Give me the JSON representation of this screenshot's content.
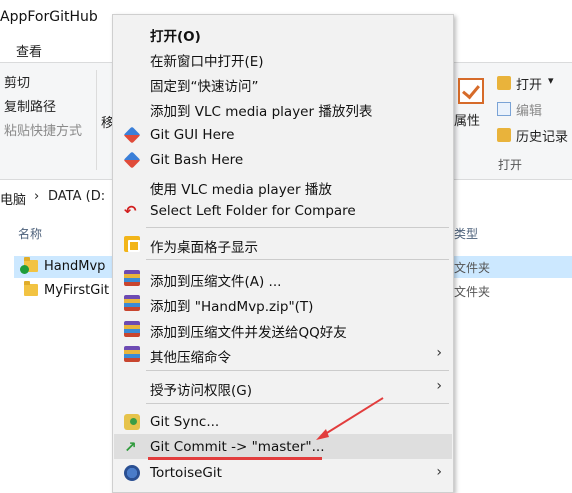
{
  "window": {
    "title": "AppForGitHub"
  },
  "ribbon": {
    "tab_label": "查看",
    "cut": "剪切",
    "copy_path": "复制路径",
    "paste_shortcut": "粘贴快捷方式",
    "move_partial": "移",
    "properties": "属性",
    "open": "打开",
    "open_arrow": "▾",
    "edit": "编辑",
    "history": "历史记录",
    "open_group": "打开"
  },
  "address": {
    "pc": "电脑",
    "sep": "›",
    "drive": "DATA (D:"
  },
  "columns": {
    "name": "名称",
    "type": "类型"
  },
  "files": [
    {
      "name": "HandMvp",
      "type": "文件夹",
      "selected": true
    },
    {
      "name": "MyFirstGit",
      "type": "文件夹",
      "selected": false
    }
  ],
  "menu": {
    "items": [
      {
        "label": "打开(O)",
        "bold": true
      },
      {
        "label": "在新窗口中打开(E)"
      },
      {
        "label": "固定到“快速访问”"
      },
      {
        "label": "添加到 VLC media player 播放列表"
      },
      {
        "label": "Git GUI Here",
        "icon": "git-icon"
      },
      {
        "label": "Git Bash Here",
        "icon": "git-icon"
      },
      {
        "label": "使用 VLC media player 播放"
      },
      {
        "label": "Select Left Folder for Compare",
        "icon": "compare-icon"
      },
      {
        "label": "作为桌面格子显示",
        "icon": "desktop-grid-icon"
      },
      {
        "label": "添加到压缩文件(A) ...",
        "icon": "archive-icon"
      },
      {
        "label": "添加到 \"HandMvp.zip\"(T)",
        "icon": "archive-icon"
      },
      {
        "label": "添加到压缩文件并发送给QQ好友",
        "icon": "archive-icon"
      },
      {
        "label": "其他压缩命令",
        "icon": "archive-icon",
        "submenu": true
      },
      {
        "label": "授予访问权限(G)",
        "submenu": true
      },
      {
        "label": "Git Sync...",
        "icon": "git-sync-icon"
      },
      {
        "label": "Git Commit -> \"master\"...",
        "icon": "git-commit-icon",
        "hover": true
      },
      {
        "label": "TortoiseGit",
        "icon": "tortoisegit-icon",
        "submenu": true
      }
    ],
    "submenu_arrow": "›"
  },
  "colors": {
    "menu_bg": "#f2f2f2",
    "menu_hover": "#dedede",
    "annotation": "#e23d3d",
    "selection": "#cce8ff"
  }
}
